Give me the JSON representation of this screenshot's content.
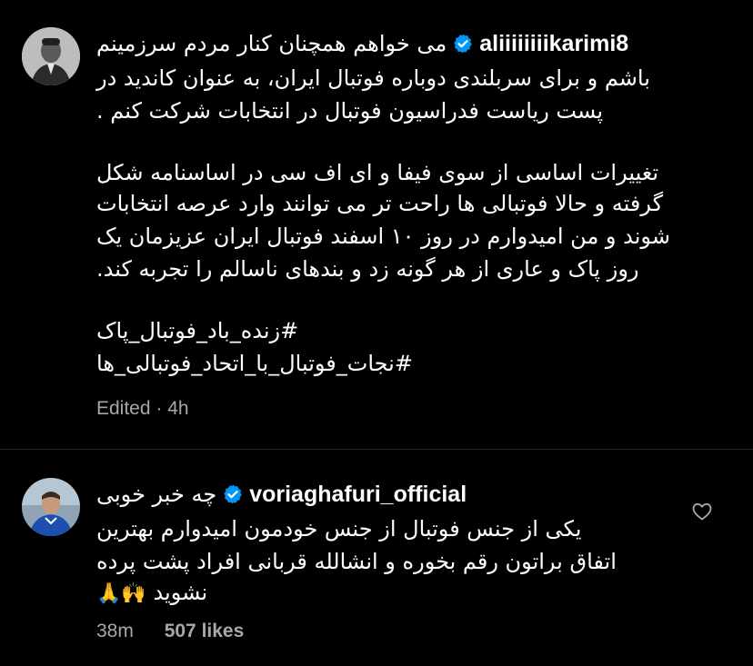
{
  "post": {
    "username": "aliiiiiiiikarimi8",
    "caption_lines": [
      "می خواهم همچنان کنار مردم سرزمینم",
      "باشم و برای سربلندی دوباره فوتبال ایران، به عنوان کاندید در",
      "پست ریاست فدراسیون فوتبال در انتخابات شرکت کنم .",
      "تغییرات اساسی از سوی فیفا و ای اف سی در اساسنامه شکل",
      "گرفته و حالا فوتبالی ها راحت تر می توانند وارد عرصه انتخابات",
      "شوند و من امیدوارم در روز ۱۰ اسفند فوتبال ایران عزیزمان  یک",
      "روز پاک و عاری از هر گونه زد و بندهای ناسالم را تجربه کند.",
      "#زنده_باد_فوتبال_پاک",
      "#نجات_فوتبال_با_اتحاد_فوتبالی_ها"
    ],
    "edited_label": "Edited",
    "separator": "·",
    "time": "4h"
  },
  "comment": {
    "username": "voriaghafuri_official",
    "text_first": "چه خبر خوبی",
    "text_lines": [
      "یکی از جنس فوتبال از جنس خودمون امیدوارم بهترین",
      "اتفاق براتون رقم بخوره و انشالله قربانی افراد پشت پرده",
      "نشوید"
    ],
    "emojis": "🙌🙏",
    "time": "38m",
    "likes": "507 likes"
  },
  "icons": {
    "verified": "verified-badge-icon",
    "heart": "heart-outline-icon"
  },
  "colors": {
    "background": "#000000",
    "text": "#ffffff",
    "secondary": "#a8a8a8",
    "verified": "#0095f6",
    "divider": "#262626"
  }
}
